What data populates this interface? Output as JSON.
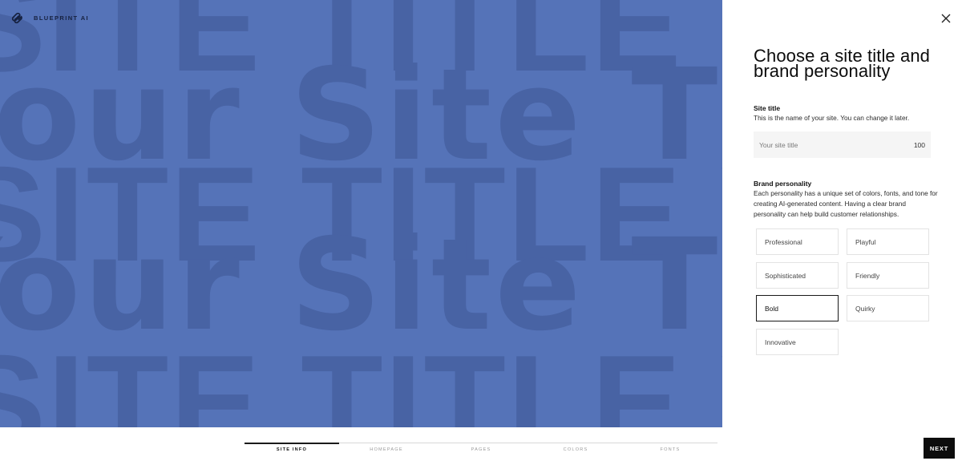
{
  "brand": {
    "name": "BLUEPRINT AI",
    "logo_icon": "squarespace-logo-icon"
  },
  "preview": {
    "background_color": "#5573b8",
    "text_color": "#4863a4",
    "line_upper": "SITE TITLE YOUR SITE TITLE YOUR SITE",
    "line_mixed": "Your Site Title Your Site Title"
  },
  "panel": {
    "close_icon": "close-icon",
    "heading": "Choose a site title and brand personality",
    "site_title": {
      "label": "Site title",
      "description": "This is the name of your site. You can change it later.",
      "placeholder": "Your site title",
      "char_count": "100"
    },
    "brand_personality": {
      "label": "Brand personality",
      "description": "Each personality has a unique set of colors, fonts, and tone for creating AI-generated content. Having a clear brand personality can help build customer relationships.",
      "options": [
        "Professional",
        "Playful",
        "Sophisticated",
        "Friendly",
        "Bold",
        "Quirky",
        "Innovative"
      ],
      "selected": "Bold"
    }
  },
  "progress": {
    "steps": [
      "SITE INFO",
      "HOMEPAGE",
      "PAGES",
      "COLORS",
      "FONTS"
    ],
    "active_step": "SITE INFO",
    "fraction_complete": 0.2
  },
  "next_button": {
    "label": "NEXT"
  }
}
